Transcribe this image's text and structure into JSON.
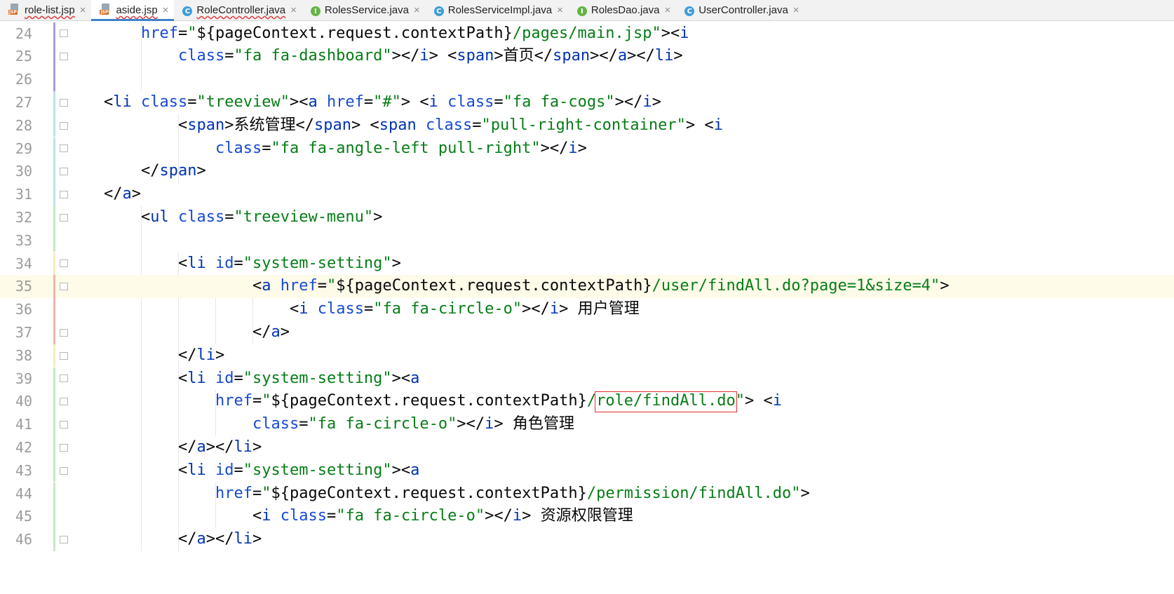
{
  "tabs": [
    {
      "label": "role-list.jsp",
      "icon": "jsp-file-icon",
      "active": false,
      "squiggle": true
    },
    {
      "label": "aside.jsp",
      "icon": "jsp-file-icon",
      "active": true,
      "squiggle": true
    },
    {
      "label": "RoleController.java",
      "icon": "class-icon",
      "active": false,
      "squiggle": true
    },
    {
      "label": "RolesService.java",
      "icon": "interface-icon",
      "active": false,
      "squiggle": false
    },
    {
      "label": "RolesServiceImpl.java",
      "icon": "class-icon",
      "active": false,
      "squiggle": false
    },
    {
      "label": "RolesDao.java",
      "icon": "interface-icon",
      "active": false,
      "squiggle": false
    },
    {
      "label": "UserController.java",
      "icon": "class-icon",
      "active": false,
      "squiggle": false
    }
  ],
  "tab_close_glyph": "×",
  "colors": {
    "tag": "#0033b3",
    "attr": "#174ad4",
    "string": "#067d17",
    "plain": "#080808",
    "line_number": "#9c9c9c",
    "current_line_bg": "#fefbe9",
    "tab_active_underline": "#4083c9",
    "red_box": "#e0312f"
  },
  "editor": {
    "current_line": 35,
    "lines": [
      {
        "n": "24",
        "tokens": [
          [
            "    ",
            "p"
          ],
          [
            "href",
            "a"
          ],
          [
            "=",
            "p"
          ],
          [
            "\"",
            "s"
          ],
          [
            "${",
            "p"
          ],
          [
            "pageContext.request.contextPath",
            "p"
          ],
          [
            "}",
            "p"
          ],
          [
            "/pages/main.jsp\"",
            "s"
          ],
          [
            "><",
            "p"
          ],
          [
            "i",
            "t"
          ]
        ]
      },
      {
        "n": "25",
        "tokens": [
          [
            "        ",
            "p"
          ],
          [
            "class",
            "a"
          ],
          [
            "=",
            "p"
          ],
          [
            "\"fa fa-dashboard\"",
            "s"
          ],
          [
            "></",
            "p"
          ],
          [
            "i",
            "t"
          ],
          [
            "> <",
            "p"
          ],
          [
            "span",
            "t"
          ],
          [
            ">首页</",
            "p"
          ],
          [
            "span",
            "t"
          ],
          [
            "></",
            "p"
          ],
          [
            "a",
            "t"
          ],
          [
            "></",
            "p"
          ],
          [
            "li",
            "t"
          ],
          [
            ">",
            "p"
          ]
        ]
      },
      {
        "n": "26",
        "tokens": []
      },
      {
        "n": "27",
        "tokens": [
          "<",
          "li"
        ],
        "hl": "li1"
      },
      {
        "n": "28",
        "tokens": []
      },
      {
        "n": "29",
        "tokens": []
      },
      {
        "n": "30",
        "tokens": []
      },
      {
        "n": "31",
        "tokens": []
      },
      {
        "n": "32",
        "tokens": []
      },
      {
        "n": "33",
        "tokens": []
      },
      {
        "n": "34",
        "tokens": []
      },
      {
        "n": "35",
        "tokens": []
      },
      {
        "n": "36",
        "tokens": []
      },
      {
        "n": "37",
        "tokens": []
      },
      {
        "n": "38",
        "tokens": []
      },
      {
        "n": "39",
        "tokens": []
      },
      {
        "n": "40",
        "tokens": []
      },
      {
        "n": "41",
        "tokens": []
      },
      {
        "n": "42",
        "tokens": []
      },
      {
        "n": "43",
        "tokens": []
      },
      {
        "n": "44",
        "tokens": []
      },
      {
        "n": "45",
        "tokens": []
      },
      {
        "n": "46",
        "tokens": []
      }
    ],
    "text": [
      "    href=\"${pageContext.request.contextPath}/pages/main.jsp\"><i",
      "        class=\"fa fa-dashboard\"></i> <span>首页</span></a></li>",
      "",
      "<li class=\"treeview\"><a href=\"#\"> <i class=\"fa fa-cogs\"></i>",
      "        <span>系统管理</span> <span class=\"pull-right-container\"> <i",
      "            class=\"fa fa-angle-left pull-right\"></i>",
      "    </span>",
      "</a>",
      "    <ul class=\"treeview-menu\">",
      "",
      "        <li id=\"system-setting\">",
      "                <a href=\"${pageContext.request.contextPath}/user/findAll.do?page=1&size=4\">",
      "                    <i class=\"fa fa-circle-o\"></i> 用户管理",
      "                </a>",
      "        </li>",
      "        <li id=\"system-setting\"><a",
      "            href=\"${pageContext.request.contextPath}/role/findAll.do\"> <i",
      "                class=\"fa fa-circle-o\"></i> 角色管理",
      "        </a></li>",
      "        <li id=\"system-setting\"><a",
      "            href=\"${pageContext.request.contextPath}/permission/findAll.do\">",
      "                <i class=\"fa fa-circle-o\"></i> 资源权限管理",
      "        </a></li>"
    ]
  }
}
